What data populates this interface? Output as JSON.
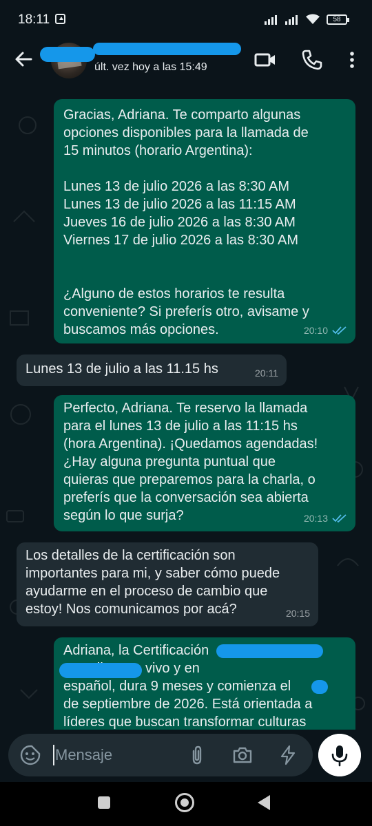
{
  "status_bar": {
    "time": "18:11",
    "battery": "58"
  },
  "header": {
    "last_seen": "últ. vez hoy a las 15:49"
  },
  "messages": [
    {
      "direction": "outgoing",
      "text": "Gracias, Adriana. Te comparto algunas\nopciones disponibles para la llamada de\n15 minutos (horario Argentina):\n\nLunes 13 de julio 2026 a las 8:30 AM\nLunes 13 de julio 2026 a las 11:15 AM\nJueves 16 de julio 2026 a las 8:30 AM\nViernes 17 de julio 2026 a las 8:30 AM\n\n\n¿Alguno de estos horarios te resulta\nconveniente? Si preferís otro, avisame y\nbuscamos más opciones.",
      "time": "20:10"
    },
    {
      "direction": "incoming",
      "text": "Lunes 13 de julio a las 11.15 hs",
      "time": "20:11"
    },
    {
      "direction": "outgoing",
      "text": "Perfecto, Adriana. Te reservo la llamada\npara el lunes 13 de julio a las 11:15 hs\n(hora Argentina). ¡Quedamos agendadas!\n¿Hay alguna pregunta puntual que\nquieras que preparemos para la charla, o\npreferís que la conversación sea abierta\nsegún lo que surja?",
      "time": "20:13"
    },
    {
      "direction": "incoming",
      "text": "Los detalles de la certificación son\nimportantes para mi, y saber cómo puede\nayudarme en el proceso de cambio que\nestoy! Nos comunicamos por acá?",
      "time": "20:15"
    },
    {
      "direction": "outgoing",
      "text": "Adriana, la Certificación\n                es online, en vivo y en\nespañol, dura 9 meses y comienza el\nde septiembre de 2026. Está orientada a\nlíderes que buscan transformar culturas"
    }
  ],
  "composer": {
    "placeholder": "Mensaje"
  },
  "icons": [
    "back-arrow-icon",
    "video-call-icon",
    "voice-call-icon",
    "more-vert-icon",
    "emoji-sticker-icon",
    "attach-icon",
    "camera-icon",
    "bolt-icon",
    "mic-icon",
    "scroll-down-icon"
  ],
  "colors": {
    "background": "#0b141a",
    "outgoing_bubble": "#005c4b",
    "incoming_bubble": "#202c33",
    "read_ticks": "#53bdeb",
    "redaction": "#1597ea"
  }
}
